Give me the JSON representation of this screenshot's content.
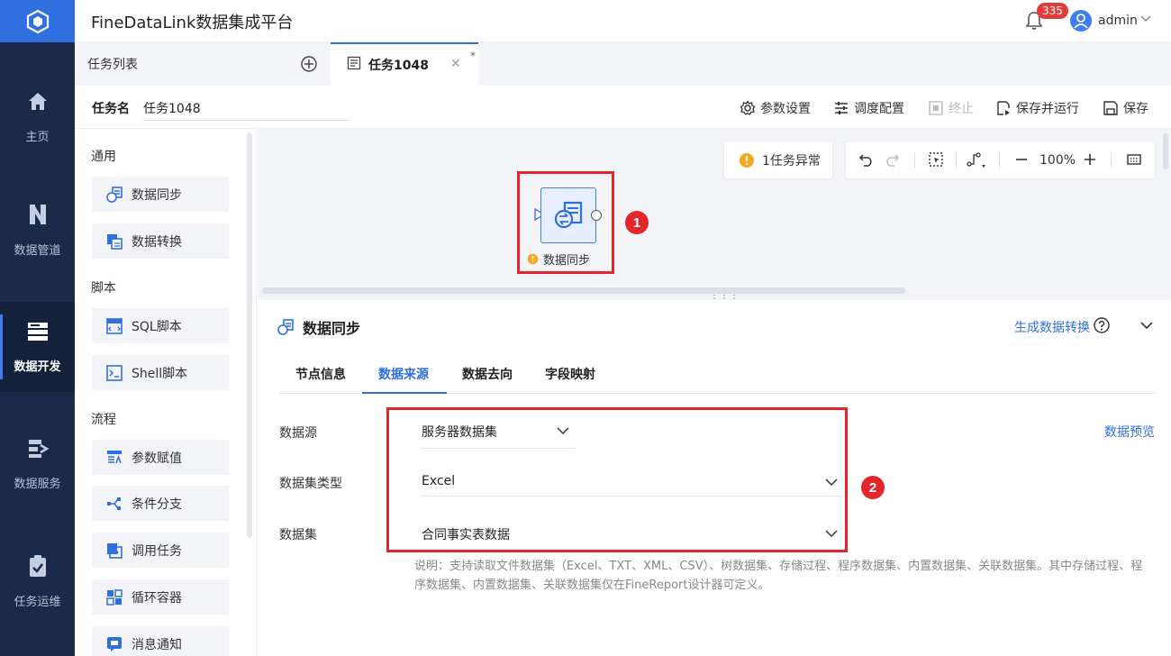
{
  "app": {
    "title": "FineDataLink数据集成平台",
    "notification_count": "335",
    "username": "admin"
  },
  "colors": {
    "sidebar_bg": "#1b2a4a",
    "accent": "#2f6fdf",
    "highlight_red": "#e3262d"
  },
  "sidebar": {
    "items": [
      {
        "label": "主页",
        "icon": "home-icon"
      },
      {
        "label": "数据管道",
        "icon": "pipeline-icon"
      },
      {
        "label": "数据开发",
        "icon": "develop-icon",
        "active": true
      },
      {
        "label": "数据服务",
        "icon": "service-icon"
      },
      {
        "label": "任务运维",
        "icon": "ops-icon"
      }
    ]
  },
  "tabs": {
    "task_list": "任务列表",
    "active_tab": "任务1048",
    "modified_mark": "*"
  },
  "task": {
    "name_label": "任务名",
    "name_value": "任务1048"
  },
  "toolbar": {
    "param_settings": "参数设置",
    "schedule_config": "调度配置",
    "stop": "终止",
    "save_and_run": "保存并运行",
    "save": "保存"
  },
  "palette": {
    "general_title": "通用",
    "general": [
      "数据同步",
      "数据转换"
    ],
    "script_title": "脚本",
    "script": [
      "SQL脚本",
      "Shell脚本"
    ],
    "flow_title": "流程",
    "flow": [
      "参数赋值",
      "条件分支",
      "调用任务",
      "循环容器",
      "消息通知"
    ]
  },
  "canvas": {
    "warning": "1任务异常",
    "zoom": "100%",
    "node_label": "数据同步",
    "marker1": "1",
    "marker2": "2"
  },
  "panel": {
    "title": "数据同步",
    "generate_transform": "生成数据转换",
    "tabs": [
      "节点信息",
      "数据来源",
      "数据去向",
      "字段映射"
    ],
    "active_tab": "数据来源",
    "fields": {
      "datasource_label": "数据源",
      "datasource_value": "服务器数据集",
      "dataset_type_label": "数据集类型",
      "dataset_type_value": "Excel",
      "dataset_label": "数据集",
      "dataset_value": "合同事实表数据"
    },
    "preview": "数据预览",
    "note": "说明：支持读取文件数据集（Excel、TXT、XML、CSV）、树数据集、存储过程、程序数据集、内置数据集、关联数据集。其中存储过程、程序数据集、内置数据集、关联数据集仅在FineReport设计器可定义。"
  }
}
